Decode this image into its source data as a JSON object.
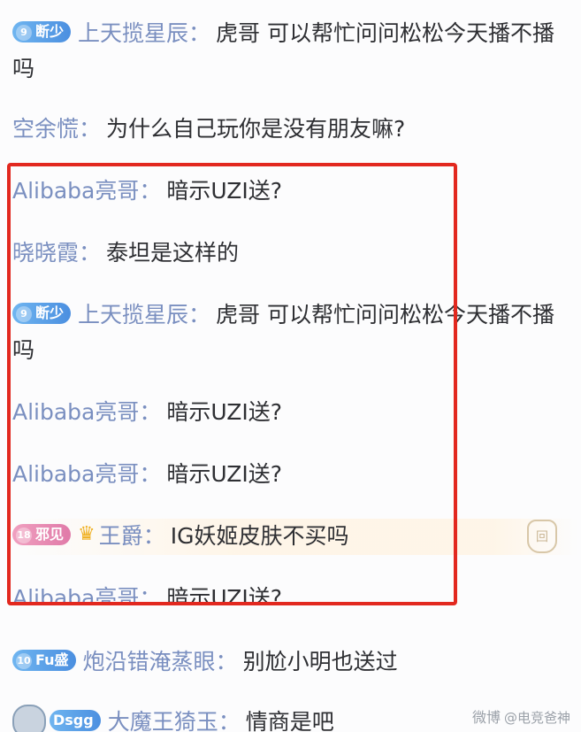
{
  "messages": [
    {
      "badge_level": "9",
      "badge_name": "断少",
      "user": "上天揽星辰",
      "sep": "：",
      "text": "虎哥  可以帮忙问问松松今天播不播吗"
    },
    {
      "user": "空余慌",
      "sep": "：",
      "text": "为什么自己玩你是没有朋友嘛?"
    },
    {
      "user": "Alibaba亮哥",
      "sep": "：",
      "text": "暗示UZI送?"
    },
    {
      "user": "晓晓霞",
      "sep": "：",
      "text": "泰坦是这样的"
    },
    {
      "badge_level": "9",
      "badge_name": "断少",
      "user": "上天揽星辰",
      "sep": "：",
      "text": "虎哥  可以帮忙问问松松今天播不播吗"
    },
    {
      "user": "Alibaba亮哥",
      "sep": "：",
      "text": "暗示UZI送?"
    },
    {
      "user": "Alibaba亮哥",
      "sep": "：",
      "text": "暗示UZI送?"
    },
    {
      "badge_level": "18",
      "badge_name": "邪见",
      "user": "王爵",
      "sep": "：",
      "text": "IG妖姬皮肤不买吗"
    },
    {
      "user": "Alibaba亮哥",
      "sep": "：",
      "text": "暗示UZI送?"
    },
    {
      "badge_level": "10",
      "badge_name": "Fu盛",
      "user": "炮沿错淹蒸眼",
      "sep": "：",
      "text": "别尬小明也送过"
    },
    {
      "badge_name": "Dsgg",
      "user": "大魔王猗玉",
      "sep": "：",
      "text": "情商是吧"
    }
  ],
  "side_icon": {
    "label": "回"
  },
  "watermark": {
    "logo": "微博",
    "text": "@电竞爸神"
  },
  "colors": {
    "highlight_border": "#e2281f",
    "username": "#7a8fc0",
    "badge_blue": "#4b8fe0",
    "badge_pink": "#e07aa8"
  }
}
